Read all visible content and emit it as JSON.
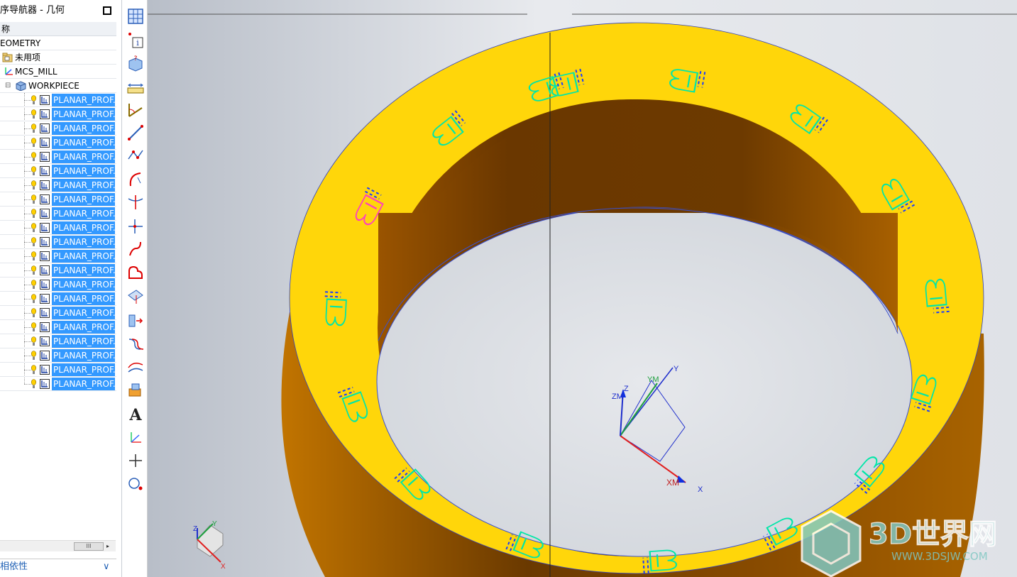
{
  "navigator": {
    "title": "序导航器 - 几何",
    "column_header": "称",
    "root": "EOMETRY",
    "unused": "未用项",
    "mcs": "MCS_MILL",
    "workpiece": "WORKPIECE",
    "operations": [
      "PLANAR_PROF.",
      "PLANAR_PROF.",
      "PLANAR_PROF.",
      "PLANAR_PROF.",
      "PLANAR_PROF.",
      "PLANAR_PROF.",
      "PLANAR_PROF.",
      "PLANAR_PROF.",
      "PLANAR_PROF.",
      "PLANAR_PROF.",
      "PLANAR_PROF.",
      "PLANAR_PROF.",
      "PLANAR_PROF.",
      "PLANAR_PROF.",
      "PLANAR_PROF.",
      "PLANAR_PROF.",
      "PLANAR_PROF.",
      "PLANAR_PROF.",
      "PLANAR_PROF.",
      "PLANAR_PROF.",
      "PLANAR_PROF."
    ],
    "scroll_thumb": "III",
    "scroll_right": "▸",
    "dependency_label": "相依性",
    "dependency_chevron": "∨"
  },
  "toolbar": {
    "icons": [
      "grid-icon",
      "info-icon",
      "object-info-icon",
      "measure-distance-icon",
      "measure-angle-icon",
      "line-icon",
      "points-icon",
      "arc-icon",
      "trim-icon",
      "intersect-icon",
      "bridge-curve-icon",
      "fillet-curve-icon",
      "offset-curve-icon",
      "project-curve-icon",
      "wrap-icon",
      "iso-curve-icon",
      "extrude-icon",
      "text-icon",
      "csys-icon",
      "point-icon",
      "circle-icon"
    ],
    "text_glyph": "A"
  },
  "viewport": {
    "wcs_labels": {
      "x": "XM",
      "y": "YM",
      "z": "ZM",
      "X": "X",
      "Y": "Y",
      "Z": "Z"
    },
    "triad_labels": {
      "x": "X",
      "y": "Y",
      "z": "Z"
    },
    "watermark_text": "3D世界网",
    "watermark_url": "WWW.3DSJW.COM",
    "colors": {
      "face": "#ffd60a",
      "wall_dark": "#6b3a00",
      "wall_light": "#b06d00",
      "toolpath": "#00e6a8",
      "selected_path": "#ff3fbf",
      "cut_marks": "#1a3cff"
    }
  }
}
